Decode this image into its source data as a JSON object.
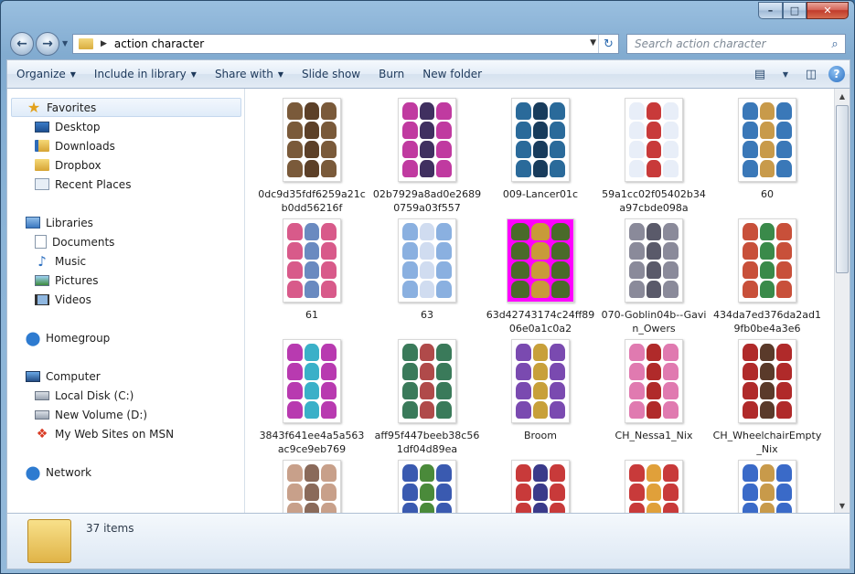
{
  "window": {
    "caption_buttons": {
      "minimize": "–",
      "maximize": "□",
      "close": "✕"
    }
  },
  "address": {
    "path": "action character",
    "separator": "▶",
    "dropdown": "▼",
    "refresh": "↻"
  },
  "search": {
    "placeholder": "Search action character",
    "icon": "search-icon"
  },
  "nav_buttons": {
    "back": "←",
    "forward": "→",
    "history": "▼"
  },
  "toolbar": {
    "organize": "Organize",
    "include_in_library": "Include in library",
    "share_with": "Share with",
    "slide_show": "Slide show",
    "burn": "Burn",
    "new_folder": "New folder",
    "dropdown_arrow": "▼",
    "help": "?"
  },
  "nav_pane": {
    "favorites": {
      "label": "Favorites",
      "items": [
        "Desktop",
        "Downloads",
        "Dropbox",
        "Recent Places"
      ]
    },
    "libraries": {
      "label": "Libraries",
      "items": [
        "Documents",
        "Music",
        "Pictures",
        "Videos"
      ]
    },
    "homegroup": {
      "label": "Homegroup"
    },
    "computer": {
      "label": "Computer",
      "items": [
        "Local Disk (C:)",
        "New Volume (D:)",
        "My Web Sites on MSN"
      ]
    },
    "network": {
      "label": "Network"
    }
  },
  "files": [
    {
      "name": "0dc9d35fdf6259a21cb0dd56216f",
      "colors": [
        "#7a5a3a",
        "#5c4028"
      ]
    },
    {
      "name": "02b7929a8ad0e26890759a03f557",
      "colors": [
        "#c03aa0",
        "#403060"
      ]
    },
    {
      "name": "009-Lancer01c",
      "colors": [
        "#2a6a9a",
        "#183c5c"
      ]
    },
    {
      "name": "59a1cc02f05402b34a97cbde098a",
      "colors": [
        "#e8eef8",
        "#c83a3a"
      ]
    },
    {
      "name": "60",
      "colors": [
        "#3a78b8",
        "#c89a4a"
      ]
    },
    {
      "name": "61",
      "colors": [
        "#d85a8a",
        "#6a8ac0"
      ]
    },
    {
      "name": "63",
      "colors": [
        "#8ab0e0",
        "#d0dcf0"
      ]
    },
    {
      "name": "63d42743174c24ff8906e0a1c0a2",
      "colors": [
        "#4a6a2a",
        "#c89a3a"
      ],
      "background": "#ff00ff"
    },
    {
      "name": "070-Goblin04b--Gavin_Owers",
      "colors": [
        "#8a8a9a",
        "#5a5a6a"
      ]
    },
    {
      "name": "434da7ed376da2ad19fb0be4a3e6",
      "colors": [
        "#c8503a",
        "#3a8a4a"
      ]
    },
    {
      "name": "3843f641ee4a5a563ac9ce9eb769",
      "colors": [
        "#b83ab0",
        "#3ab0c8"
      ]
    },
    {
      "name": "aff95f447beeb38c561df04d89ea",
      "colors": [
        "#3a7a5a",
        "#b04a4a"
      ]
    },
    {
      "name": "Broom",
      "colors": [
        "#7a4ab0",
        "#c8a03a"
      ]
    },
    {
      "name": "CH_Nessa1_Nix",
      "colors": [
        "#e07ab0",
        "#b02a2a"
      ]
    },
    {
      "name": "CH_WheelchairEmpty_Nix",
      "colors": [
        "#b02a2a",
        "#5a3a2a"
      ]
    },
    {
      "name": "",
      "colors": [
        "#c8a08a",
        "#8a6a5a"
      ]
    },
    {
      "name": "",
      "colors": [
        "#3a5ab0",
        "#4a8a3a"
      ]
    },
    {
      "name": "",
      "colors": [
        "#c83a3a",
        "#3a3a8a"
      ]
    },
    {
      "name": "",
      "colors": [
        "#c83a3a",
        "#e0a03a"
      ]
    },
    {
      "name": "",
      "colors": [
        "#3a6ac8",
        "#c89a4a"
      ]
    }
  ],
  "details": {
    "count_text": "37 items"
  }
}
